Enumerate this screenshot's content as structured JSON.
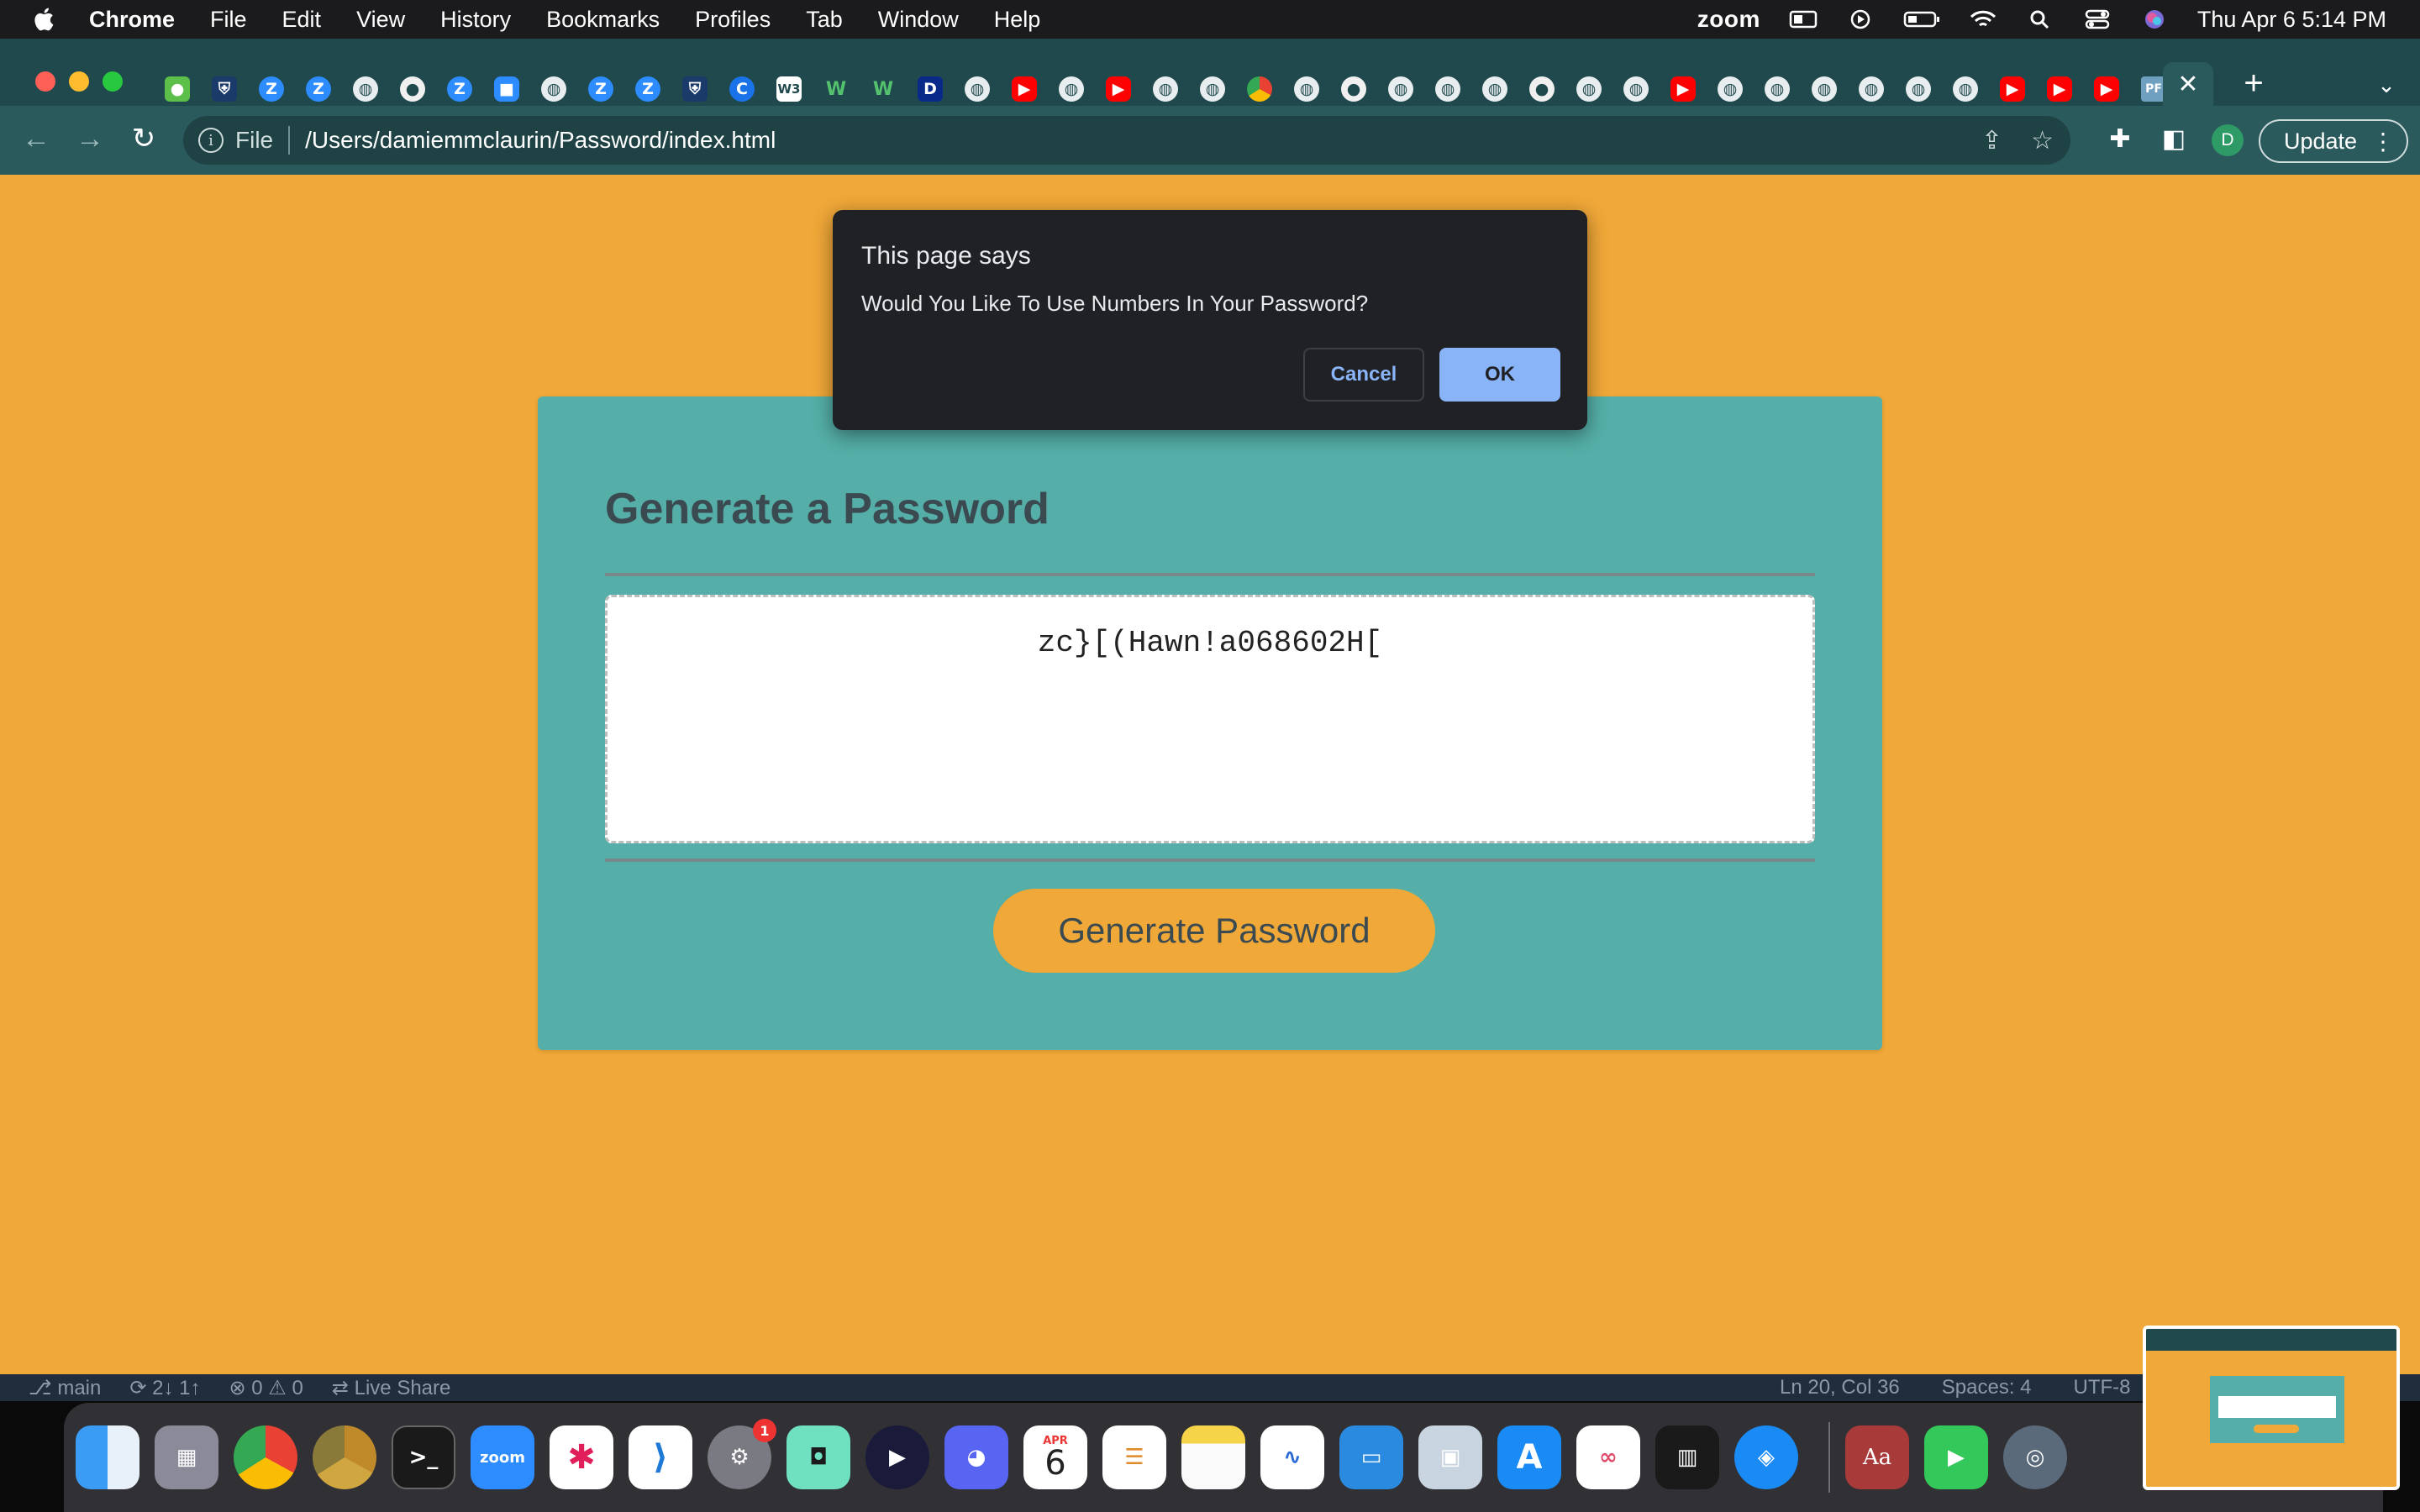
{
  "menubar": {
    "app": "Chrome",
    "items": [
      "File",
      "Edit",
      "View",
      "History",
      "Bookmarks",
      "Profiles",
      "Tab",
      "Window",
      "Help"
    ],
    "zoom": "zoom",
    "clock": "Thu Apr 6  5:14 PM"
  },
  "browser": {
    "scheme": "File",
    "url": "/Users/damiemmclaurin/Password/index.html",
    "update_label": "Update",
    "profile_initial": "D",
    "tab_icons": [
      "frog-icon",
      "shield-icon",
      "zoom-icon",
      "zoom-icon",
      "globe-icon",
      "github-icon",
      "zoom-icon",
      "zoom-video-icon",
      "globe-icon",
      "zoom-icon",
      "zoom-icon",
      "shield-icon",
      "circle-c-icon",
      "w3-icon",
      "w-icon",
      "w-icon",
      "d-icon",
      "globe-icon",
      "youtube-icon",
      "globe-icon",
      "youtube-icon",
      "globe-icon",
      "globe-icon",
      "chrome-icon",
      "globe-icon",
      "github-icon",
      "globe-icon",
      "globe-icon",
      "globe-icon",
      "github-icon",
      "globe-icon",
      "globe-icon",
      "youtube-icon",
      "globe-icon",
      "globe-icon",
      "globe-icon",
      "globe-icon",
      "globe-icon",
      "globe-icon",
      "youtube-icon",
      "youtube-icon",
      "youtube-icon",
      "pf-icon"
    ]
  },
  "page": {
    "title": "Generate a Password",
    "password": "zc}[(Hawn!a068602H[",
    "button": "Generate Password",
    "background": "#f0a838",
    "card_color": "#55afa8"
  },
  "dialog": {
    "title": "This page says",
    "message": "Would You Like To Use Numbers In Your Password?",
    "cancel": "Cancel",
    "ok": "OK"
  },
  "vscode_status": {
    "branch": "main",
    "sync": "2↓ 1↑",
    "problems": "⊗ 0 ⚠ 0",
    "live_share": "Live Share",
    "position": "Ln 20, Col 36",
    "spaces": "Spaces: 4",
    "encoding": "UTF-8"
  },
  "dock": {
    "calendar_month": "APR",
    "calendar_day": "6",
    "settings_badge": "1",
    "zoom_label": "zoom",
    "dictionary_label": "Aa"
  }
}
